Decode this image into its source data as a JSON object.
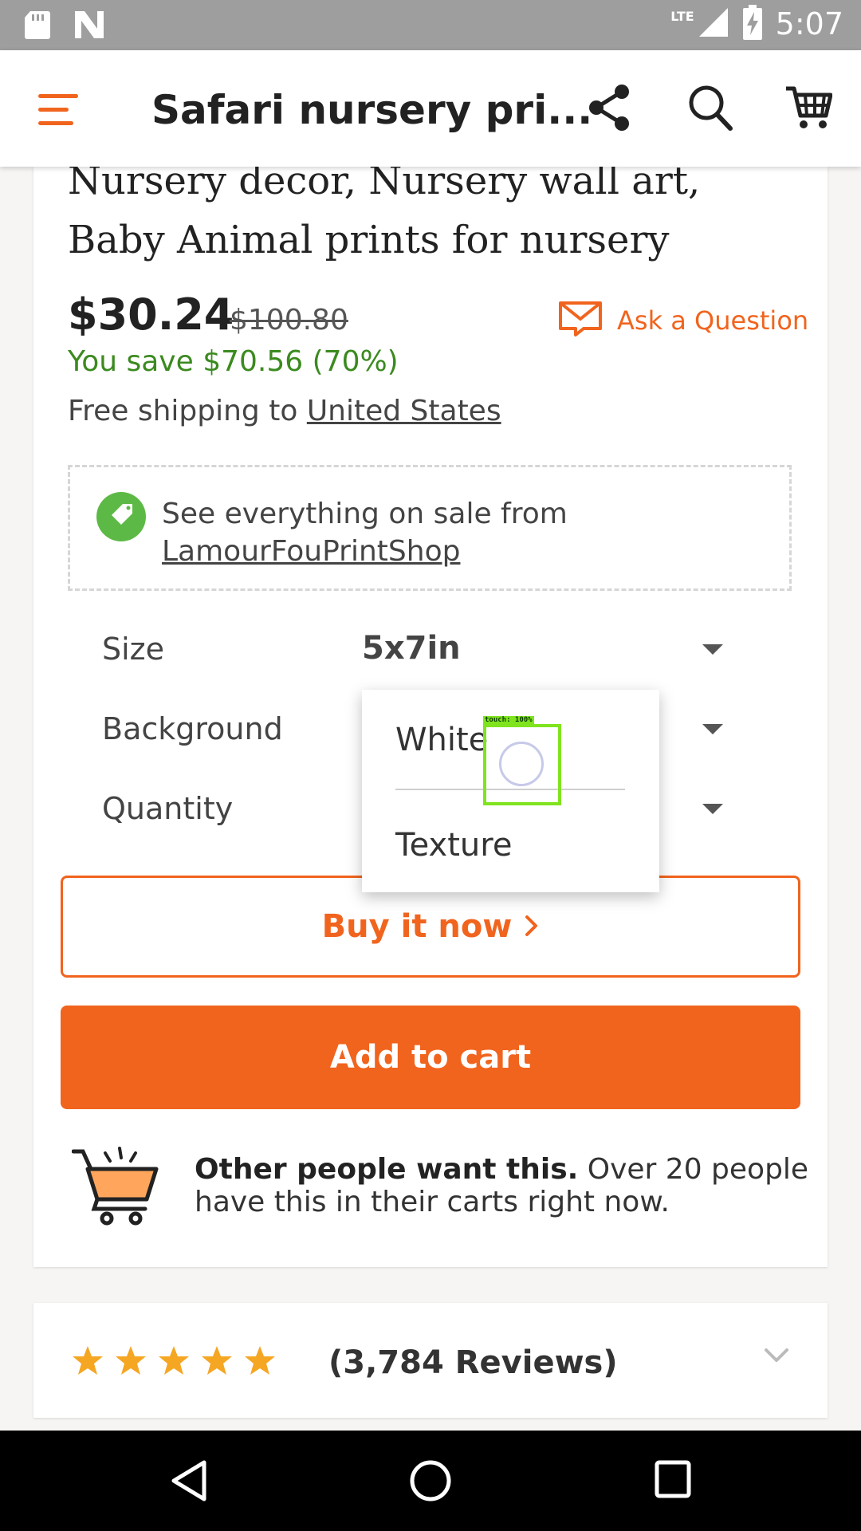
{
  "status_bar": {
    "time": "5:07",
    "network": "LTE"
  },
  "app_bar": {
    "title": "Safari nursery pri..."
  },
  "product": {
    "title": "Nursery decor, Nursery wall art, Baby Animal prints for nursery",
    "price": "$30.24",
    "original_price": "$100.80",
    "savings": "You save $70.56 (70%)",
    "ask_question_label": "Ask a Question",
    "shipping_prefix": "Free shipping to ",
    "shipping_destination": "United States"
  },
  "sale_banner": {
    "text": "See everything on sale from",
    "shop_name": "LamourFouPrintShop"
  },
  "options": {
    "size": {
      "label": "Size",
      "value": "5x7in"
    },
    "background": {
      "label": "Background"
    },
    "quantity": {
      "label": "Quantity"
    }
  },
  "dropdown": {
    "options": [
      "White",
      "Texture"
    ]
  },
  "touch_indicator": {
    "label": "touch: 100%"
  },
  "buttons": {
    "buy_now": "Buy it now",
    "add_to_cart": "Add to cart"
  },
  "social_proof": {
    "bold": "Other people want this.",
    "text": " Over 20 people have this in their carts right now."
  },
  "reviews": {
    "count_label": "(3,784 Reviews)",
    "rating": 5
  },
  "colors": {
    "accent": "#f1641e",
    "savings_green": "#3b8a1f",
    "sale_tag_green": "#5db945",
    "star_color": "#f5a623"
  }
}
